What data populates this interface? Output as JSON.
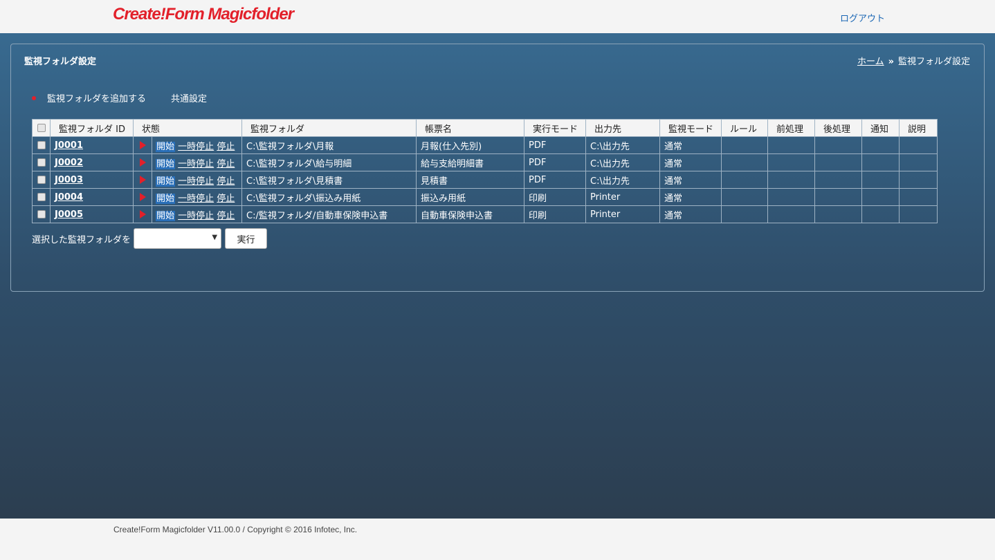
{
  "header": {
    "logo": "Create!Form Magicfolder",
    "logout": "ログアウト"
  },
  "panel": {
    "title": "監視フォルダ設定",
    "breadcrumb": {
      "home": "ホーム",
      "separator": "»",
      "current": "監視フォルダ設定"
    },
    "actions": {
      "add": "監視フォルダを追加する",
      "common": "共通設定"
    }
  },
  "table": {
    "columns": [
      "監視フォルダ ID",
      "状態",
      "監視フォルダ",
      "帳票名",
      "実行モード",
      "出力先",
      "監視モード",
      "ルール",
      "前処理",
      "後処理",
      "通知",
      "説明"
    ],
    "state_labels": {
      "start": "開始",
      "pause": "一時停止",
      "stop": "停止"
    },
    "rows": [
      {
        "id": "J0001",
        "folder": "C:\\監視フォルダ\\月報",
        "form": "月報(仕入先別)",
        "mode": "PDF",
        "output": "C:\\出力先",
        "watch": "通常",
        "rule": "",
        "pre": "",
        "post": "",
        "notify": "",
        "desc": ""
      },
      {
        "id": "J0002",
        "folder": "C:\\監視フォルダ\\給与明細",
        "form": "給与支給明細書",
        "mode": "PDF",
        "output": "C:\\出力先",
        "watch": "通常",
        "rule": "",
        "pre": "",
        "post": "",
        "notify": "",
        "desc": ""
      },
      {
        "id": "J0003",
        "folder": "C:\\監視フォルダ\\見積書",
        "form": "見積書",
        "mode": "PDF",
        "output": "C:\\出力先",
        "watch": "通常",
        "rule": "",
        "pre": "",
        "post": "",
        "notify": "",
        "desc": ""
      },
      {
        "id": "J0004",
        "folder": "C:\\監視フォルダ\\振込み用紙",
        "form": "振込み用紙",
        "mode": "印刷",
        "output": "Printer",
        "watch": "通常",
        "rule": "",
        "pre": "",
        "post": "",
        "notify": "",
        "desc": ""
      },
      {
        "id": "J0005",
        "folder": "C:/監視フォルダ/自動車保険申込書",
        "form": "自動車保険申込書",
        "mode": "印刷",
        "output": "Printer",
        "watch": "通常",
        "rule": "",
        "pre": "",
        "post": "",
        "notify": "",
        "desc": ""
      }
    ]
  },
  "bulk": {
    "label": "選択した監視フォルダを",
    "selected": "",
    "exec": "実行"
  },
  "footer": {
    "text": "Create!Form Magicfolder V11.00.0 / Copyright © 2016 Infotec, Inc."
  },
  "colors": {
    "accent": "#e2202a",
    "link": "#1a66b4",
    "bg_top": "#386a90",
    "bg_bottom": "#2c3e50"
  }
}
